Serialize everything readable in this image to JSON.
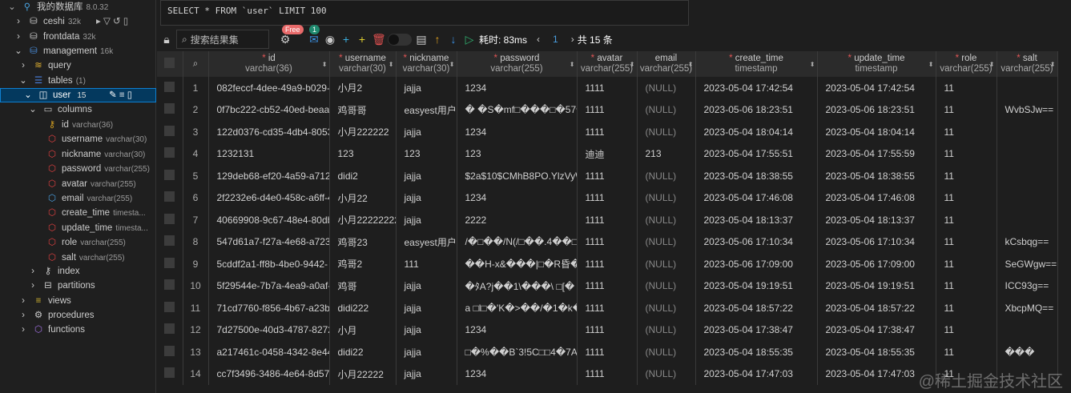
{
  "sidebar": {
    "connection": {
      "name": "我的数据库",
      "version": "8.0.32"
    },
    "databases": [
      {
        "name": "ceshi",
        "size": "32k"
      },
      {
        "name": "frontdata",
        "size": "32k"
      },
      {
        "name": "management",
        "size": "16k"
      }
    ],
    "query": "query",
    "tables": "tables",
    "tables_count": "(1)",
    "table": {
      "name": "user",
      "count": "15"
    },
    "columns_label": "columns",
    "columns": [
      {
        "name": "id",
        "type": "varchar(36)",
        "kind": "key"
      },
      {
        "name": "username",
        "type": "varchar(30)",
        "kind": "req"
      },
      {
        "name": "nickname",
        "type": "varchar(30)",
        "kind": "req"
      },
      {
        "name": "password",
        "type": "varchar(255)",
        "kind": "req"
      },
      {
        "name": "avatar",
        "type": "varchar(255)",
        "kind": "req"
      },
      {
        "name": "email",
        "type": "varchar(255)",
        "kind": "opt"
      },
      {
        "name": "create_time",
        "type": "timesta...",
        "kind": "req"
      },
      {
        "name": "update_time",
        "type": "timesta...",
        "kind": "req"
      },
      {
        "name": "role",
        "type": "varchar(255)",
        "kind": "req"
      },
      {
        "name": "salt",
        "type": "varchar(255)",
        "kind": "req"
      }
    ],
    "index": "index",
    "partitions": "partitions",
    "views": "views",
    "procedures": "procedures",
    "functions": "functions"
  },
  "sql": "SELECT * FROM `user` LIMIT 100",
  "toolbar": {
    "search_placeholder": "搜索结果集",
    "free_badge": "Free",
    "mail_badge": "1",
    "elapsed": "耗时: 83ms",
    "page": "1",
    "total": "共 15 条"
  },
  "headers": [
    {
      "name": "id",
      "type": "varchar(36)"
    },
    {
      "name": "username",
      "type": "varchar(30)"
    },
    {
      "name": "nickname",
      "type": "varchar(30)"
    },
    {
      "name": "password",
      "type": "varchar(255)"
    },
    {
      "name": "avatar",
      "type": "varchar(255)"
    },
    {
      "name": "email",
      "type": "varchar(255)",
      "optional": true
    },
    {
      "name": "create_time",
      "type": "timestamp"
    },
    {
      "name": "update_time",
      "type": "timestamp"
    },
    {
      "name": "role",
      "type": "varchar(255)"
    },
    {
      "name": "salt",
      "type": "varchar(255)"
    }
  ],
  "rows": [
    [
      "082feccf-4dee-49a9-b029-5",
      "小月2",
      "jajja",
      "1234",
      "1111",
      "(NULL)",
      "2023-05-04 17:42:54",
      "2023-05-04 17:42:54",
      "11",
      ""
    ],
    [
      "0f7bc222-cb52-40ed-beaa-",
      "鸡哥哥",
      "easyest用户",
      "� �S�mf□���□�57��",
      "1111",
      "(NULL)",
      "2023-05-06 18:23:51",
      "2023-05-06 18:23:51",
      "11",
      "WvbSJw=="
    ],
    [
      "122d0376-cd35-4db4-8053",
      "小月222222",
      "jajja",
      "1234",
      "1111",
      "(NULL)",
      "2023-05-04 18:04:14",
      "2023-05-04 18:04:14",
      "11",
      ""
    ],
    [
      "1232131",
      "123",
      "123",
      "123",
      "迪迪",
      "213",
      "2023-05-04 17:55:51",
      "2023-05-04 17:55:59",
      "11",
      ""
    ],
    [
      "129deb68-ef20-4a59-a712-",
      "didi2",
      "jajja",
      "$2a$10$CMhB8PO.YlzVyW",
      "1111",
      "(NULL)",
      "2023-05-04 18:38:55",
      "2023-05-04 18:38:55",
      "11",
      ""
    ],
    [
      "2f2232e6-d4e0-458c-a6ff-4",
      "小月22",
      "jajja",
      "1234",
      "1111",
      "(NULL)",
      "2023-05-04 17:46:08",
      "2023-05-04 17:46:08",
      "11",
      ""
    ],
    [
      "40669908-9c67-48e4-80db",
      "小月22222222",
      "jajja",
      "2222",
      "1111",
      "(NULL)",
      "2023-05-04 18:13:37",
      "2023-05-04 18:13:37",
      "11",
      ""
    ],
    [
      "547d61a7-f27a-4e68-a723-",
      "鸡哥23",
      "easyest用户",
      "/�□��/N(/□��.4��□",
      "1111",
      "(NULL)",
      "2023-05-06 17:10:34",
      "2023-05-06 17:10:34",
      "11",
      "kCsbqg=="
    ],
    [
      "5cddf2a1-ff8b-4be0-9442-",
      "鸡哥2",
      "111",
      "��H-x&���|□�R昏�.",
      "1111",
      "(NULL)",
      "2023-05-06 17:09:00",
      "2023-05-06 17:09:00",
      "11",
      "SeGWgw=="
    ],
    [
      "5f29544e-7b7a-4ea9-a0af-",
      "鸡哥",
      "jajja",
      "�ﾀA?j��1\\���\\ □[�",
      "1111",
      "(NULL)",
      "2023-05-04 19:19:51",
      "2023-05-04 19:19:51",
      "11",
      "ICC93g=="
    ],
    [
      "71cd7760-f856-4b67-a23b-",
      "didi222",
      "jajja",
      "a □l□�'K�>��/�1�k�",
      "1111",
      "(NULL)",
      "2023-05-04 18:57:22",
      "2023-05-04 18:57:22",
      "11",
      "XbcpMQ=="
    ],
    [
      "7d27500e-40d3-4787-8272",
      "小月",
      "jajja",
      "1234",
      "1111",
      "(NULL)",
      "2023-05-04 17:38:47",
      "2023-05-04 17:38:47",
      "11",
      ""
    ],
    [
      "a217461c-0458-4342-8e44-",
      "didi22",
      "jajja",
      "□�%��B`3!5C□□4�7A%",
      "1111",
      "(NULL)",
      "2023-05-04 18:55:35",
      "2023-05-04 18:55:35",
      "11",
      "���"
    ],
    [
      "cc7f3496-3486-4e64-8d57-",
      "小月22222",
      "jajja",
      "1234",
      "1111",
      "(NULL)",
      "2023-05-04 17:47:03",
      "2023-05-04 17:47:03",
      "11",
      ""
    ]
  ],
  "watermark": "@稀土掘金技术社区"
}
